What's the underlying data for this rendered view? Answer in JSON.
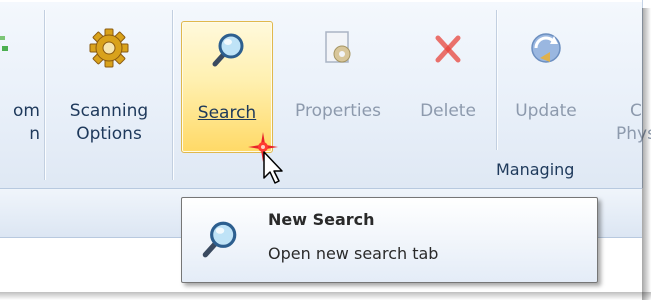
{
  "ribbon": {
    "buttons": [
      {
        "label_line1": "om",
        "label_line2": "n",
        "icon": "custom-scan-icon",
        "state": "normal"
      },
      {
        "label_line1": "Scanning",
        "label_line2": "Options",
        "icon": "gear-icon",
        "state": "normal"
      },
      {
        "label_line1": "Search",
        "label_line2": "",
        "icon": "magnifier-icon",
        "state": "active"
      },
      {
        "label_line1": "Properties",
        "label_line2": "",
        "icon": "properties-gear-document-icon",
        "state": "disabled"
      },
      {
        "label_line1": "Delete",
        "label_line2": "",
        "icon": "red-x-icon",
        "state": "disabled"
      },
      {
        "label_line1": "Update",
        "label_line2": "",
        "icon": "update-sync-icon",
        "state": "disabled"
      },
      {
        "label_line1": "C",
        "label_line2": "Phys",
        "icon": "partial-button-icon",
        "state": "disabled"
      }
    ],
    "group_label": "Managing"
  },
  "tooltip": {
    "title": "New Search",
    "description": "Open new search tab",
    "icon": "magnifier-icon"
  },
  "colors": {
    "accent_text": "#1e395b",
    "active_button": "#ffd966",
    "disabled_text": "#8d9aad",
    "delete_red": "#e8453c"
  }
}
